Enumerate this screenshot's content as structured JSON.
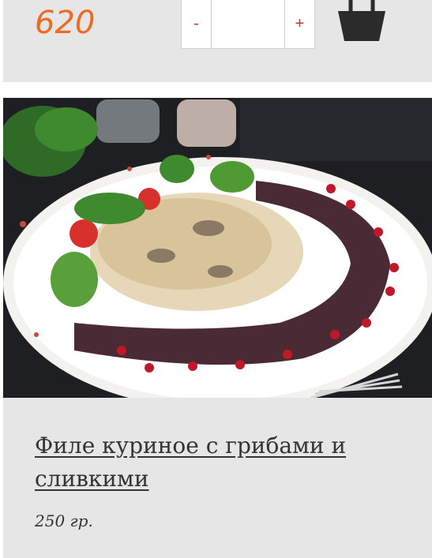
{
  "prev_product": {
    "price": "620",
    "quantity": {
      "minus_label": "-",
      "plus_label": "+",
      "value": ""
    },
    "cart_icon": "shopping-bag-icon"
  },
  "product": {
    "image_name": "dish-photo",
    "title": "Филе куриное с грибами и сливкими",
    "weight": "250 гр."
  },
  "colors": {
    "price": "#ef6a22",
    "qty_sign": "#c0392b",
    "card_bg": "#e6e6e6",
    "text": "#333333"
  }
}
